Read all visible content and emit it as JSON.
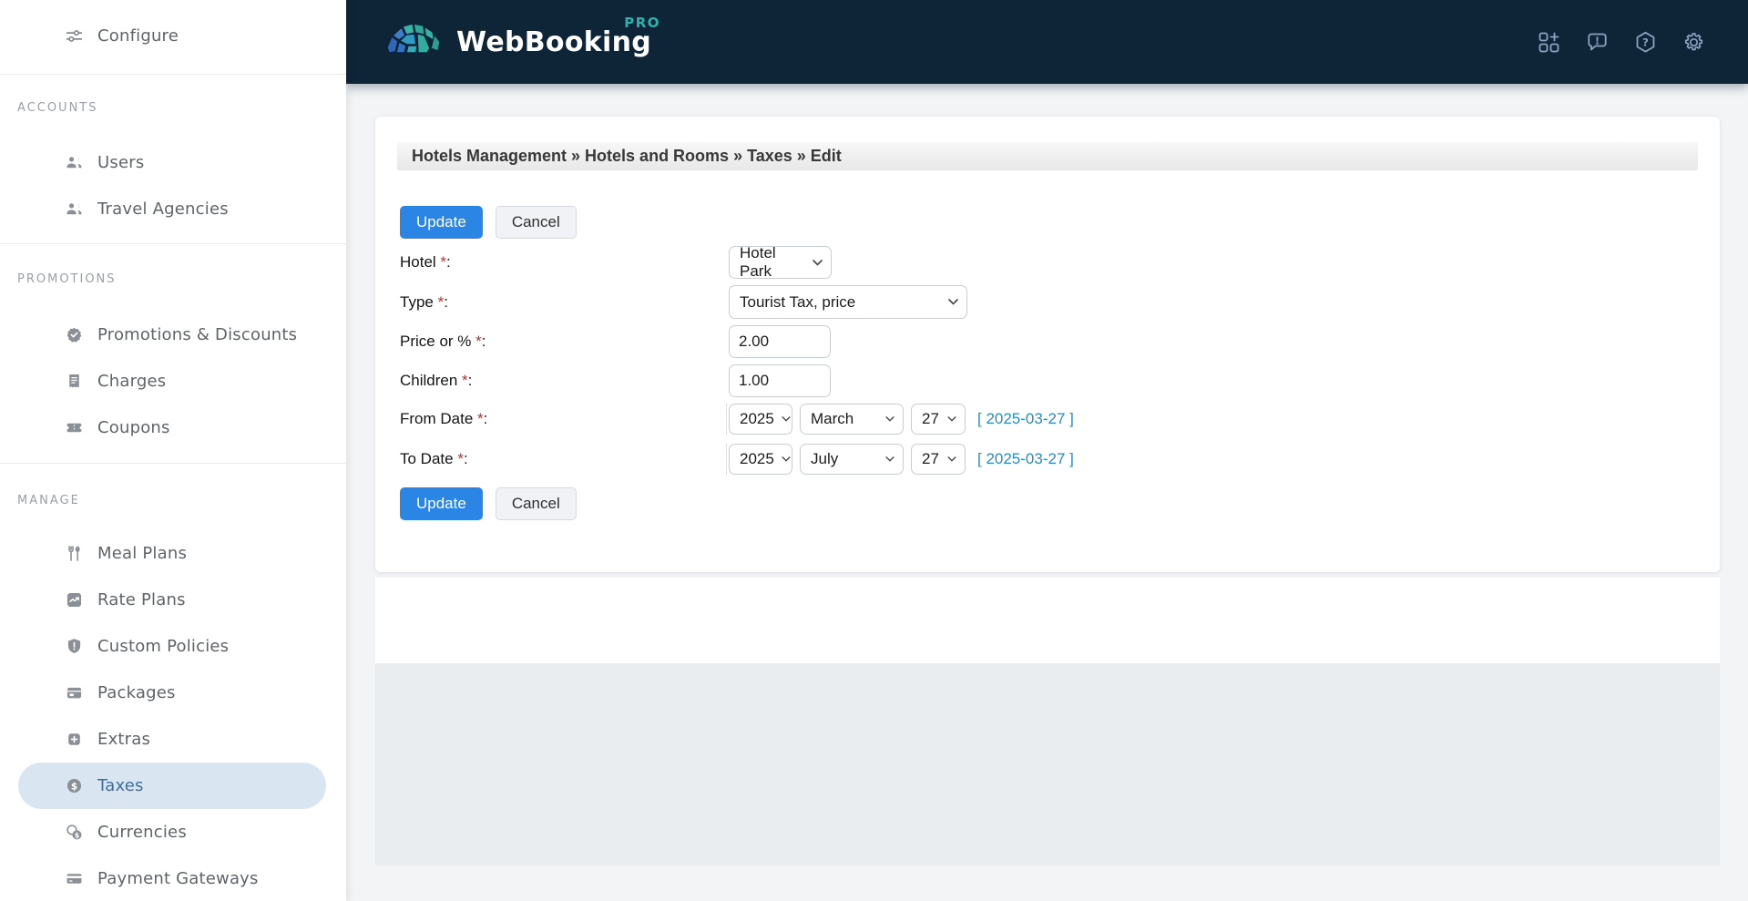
{
  "header": {
    "brand": "WebBooking",
    "brand_badge": "PRO",
    "icons": [
      "apps-add",
      "feedback",
      "help",
      "settings"
    ]
  },
  "sidebar": {
    "top_item": {
      "label": "Configure",
      "icon": "sliders"
    },
    "sections": [
      {
        "heading": "ACCOUNTS",
        "items": [
          {
            "label": "Users",
            "icon": "users"
          },
          {
            "label": "Travel Agencies",
            "icon": "users"
          }
        ]
      },
      {
        "heading": "PROMOTIONS",
        "items": [
          {
            "label": "Promotions & Discounts",
            "icon": "badge-check"
          },
          {
            "label": "Charges",
            "icon": "receipt"
          },
          {
            "label": "Coupons",
            "icon": "ticket"
          }
        ]
      },
      {
        "heading": "MANAGE",
        "items": [
          {
            "label": "Meal Plans",
            "icon": "cutlery"
          },
          {
            "label": "Rate Plans",
            "icon": "trend-chart"
          },
          {
            "label": "Custom Policies",
            "icon": "shield"
          },
          {
            "label": "Packages",
            "icon": "box"
          },
          {
            "label": "Extras",
            "icon": "plus-square"
          },
          {
            "label": "Taxes",
            "icon": "dollar-coin",
            "active": true
          },
          {
            "label": "Currencies",
            "icon": "coins"
          },
          {
            "label": "Payment Gateways",
            "icon": "credit-card"
          }
        ]
      }
    ]
  },
  "main": {
    "breadcrumb": "Hotels Management » Hotels and Rooms » Taxes » Edit",
    "buttons": {
      "update": "Update",
      "cancel": "Cancel"
    },
    "form": {
      "req": " *",
      "colon": ":",
      "hotel": {
        "label": "Hotel",
        "value": "Hotel Park"
      },
      "type": {
        "label": "Type",
        "value": "Tourist Tax, price"
      },
      "price": {
        "label": "Price or %",
        "value": "2.00"
      },
      "children": {
        "label": "Children",
        "value": "1.00"
      },
      "from_date": {
        "label": "From Date",
        "year": "2025",
        "month": "March",
        "day": "27",
        "link": "[ 2025-03-27 ]"
      },
      "to_date": {
        "label": "To Date",
        "year": "2025",
        "month": "July",
        "day": "27",
        "link": "[ 2025-03-27 ]"
      }
    }
  },
  "colors": {
    "header_bg": "#0e2437",
    "accent_blue": "#2b85e4",
    "link_blue": "#2a8cc0",
    "active_item_bg": "#d9e6f2",
    "active_item_text": "#3c6e9e",
    "pro_teal": "#2bb3ad",
    "required_red": "#b23434",
    "gray_block": "#e9edf0",
    "page_bg": "#f3f4f6"
  }
}
